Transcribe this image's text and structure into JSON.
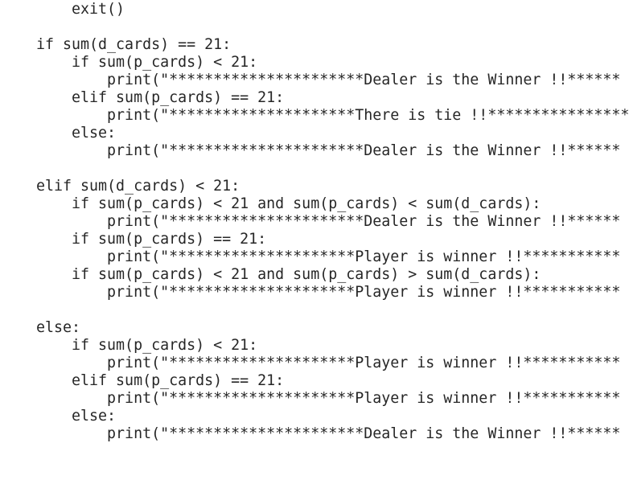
{
  "editor": {
    "lines": [
      "    exit()",
      "",
      "if sum(d_cards) == 21:",
      "    if sum(p_cards) < 21:",
      "        print(\"**********************Dealer is the Winner !!******",
      "    elif sum(p_cards) == 21:",
      "        print(\"*********************There is tie !!******************",
      "    else:",
      "        print(\"**********************Dealer is the Winner !!******",
      "",
      "elif sum(d_cards) < 21:",
      "    if sum(p_cards) < 21 and sum(p_cards) < sum(d_cards):",
      "        print(\"**********************Dealer is the Winner !!******",
      "    if sum(p_cards) == 21:",
      "        print(\"*********************Player is winner !!***********",
      "    if sum(p_cards) < 21 and sum(p_cards) > sum(d_cards):",
      "        print(\"*********************Player is winner !!***********",
      "",
      "else:",
      "    if sum(p_cards) < 21:",
      "        print(\"*********************Player is winner !!***********",
      "    elif sum(p_cards) == 21:",
      "        print(\"*********************Player is winner !!***********",
      "    else:",
      "        print(\"**********************Dealer is the Winner !!******"
    ]
  },
  "colors": {
    "background": "#ffffff",
    "text": "#262626"
  }
}
